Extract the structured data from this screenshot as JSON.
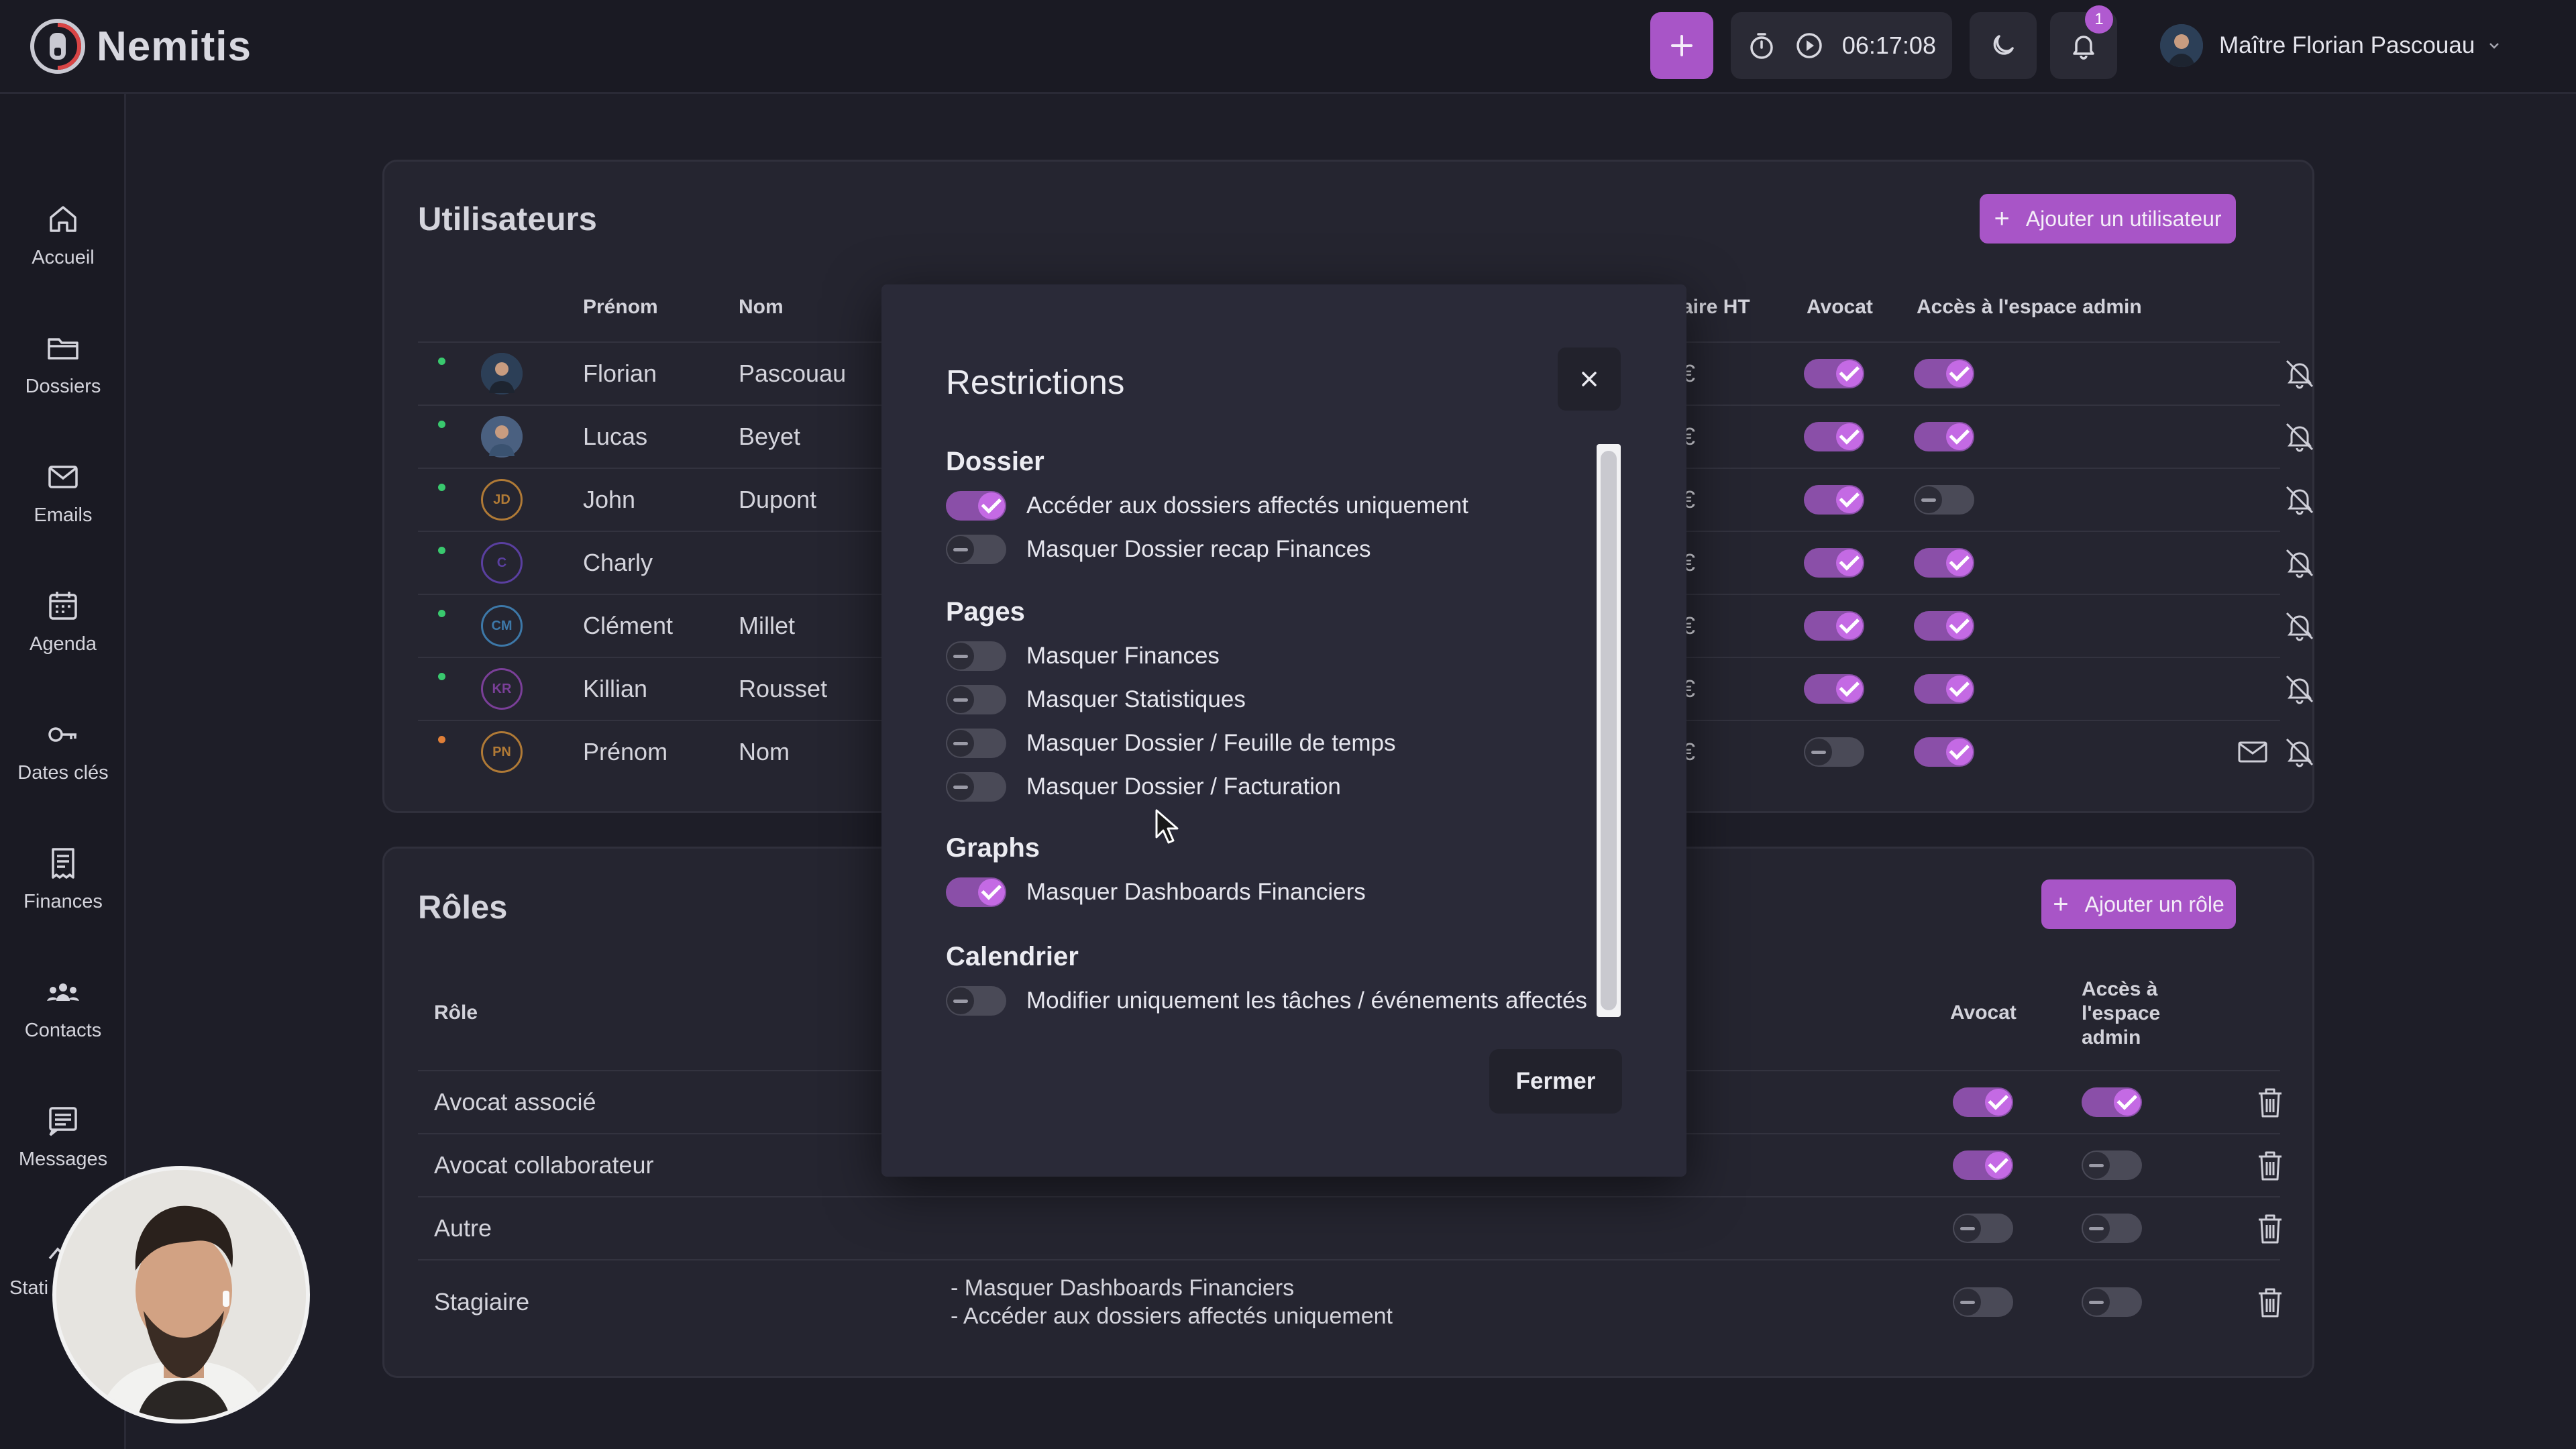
{
  "app": {
    "name": "Nemitis"
  },
  "topbar": {
    "timer": "06:17:08",
    "notifications_count": "1",
    "user_name": "Maître Florian Pascouau"
  },
  "sidebar": {
    "items": [
      {
        "label": "Accueil",
        "icon": "home-icon"
      },
      {
        "label": "Dossiers",
        "icon": "folder-icon"
      },
      {
        "label": "Emails",
        "icon": "mail-icon"
      },
      {
        "label": "Agenda",
        "icon": "calendar-icon"
      },
      {
        "label": "Dates clés",
        "icon": "key-icon"
      },
      {
        "label": "Finances",
        "icon": "receipt-icon"
      },
      {
        "label": "Contacts",
        "icon": "contacts-icon"
      },
      {
        "label": "Messages",
        "icon": "messages-icon"
      },
      {
        "label": "Stati",
        "icon": "stats-icon"
      }
    ]
  },
  "users": {
    "title": "Utilisateurs",
    "add_button": "Ajouter un utilisateur",
    "headers": {
      "firstname": "Prénom",
      "lastname": "Nom",
      "rate": "aire HT",
      "lawyer": "Avocat",
      "admin": "Accès à l'espace admin"
    },
    "rows": [
      {
        "status": "online",
        "initials": "",
        "firstname": "Florian",
        "lastname": "Pascouau",
        "rate": "€",
        "lawyer": true,
        "admin": true,
        "mail": false
      },
      {
        "status": "online",
        "initials": "",
        "firstname": "Lucas",
        "lastname": "Beyet",
        "rate": "€",
        "lawyer": true,
        "admin": true,
        "mail": false
      },
      {
        "status": "online",
        "initials": "JD",
        "firstname": "John",
        "lastname": "Dupont",
        "rate": "€",
        "lawyer": true,
        "admin": false,
        "mail": false
      },
      {
        "status": "online",
        "initials": "C",
        "firstname": "Charly",
        "lastname": "",
        "rate": "€",
        "lawyer": true,
        "admin": true,
        "mail": false
      },
      {
        "status": "online",
        "initials": "CM",
        "firstname": "Clément",
        "lastname": "Millet",
        "rate": "€",
        "lawyer": true,
        "admin": true,
        "mail": false
      },
      {
        "status": "online",
        "initials": "KR",
        "firstname": "Killian",
        "lastname": "Rousset",
        "rate": "€",
        "lawyer": true,
        "admin": true,
        "mail": false
      },
      {
        "status": "pending",
        "initials": "PN",
        "firstname": "Prénom",
        "lastname": "Nom",
        "rate": "€",
        "lawyer": false,
        "admin": true,
        "mail": true
      }
    ]
  },
  "roles": {
    "title": "Rôles",
    "add_button": "Ajouter un rôle",
    "headers": {
      "role": "Rôle",
      "lawyer": "Avocat",
      "admin_line1": "Accès à",
      "admin_line2": "l'espace",
      "admin_line3": "admin"
    },
    "rows": [
      {
        "name": "Avocat associé",
        "restrictions": [],
        "lawyer": true,
        "admin": true
      },
      {
        "name": "Avocat collaborateur",
        "restrictions": [],
        "lawyer": true,
        "admin": false
      },
      {
        "name": "Autre",
        "restrictions": [],
        "lawyer": false,
        "admin": false
      },
      {
        "name": "Stagiaire",
        "restrictions": [
          "- Masquer Dashboards Financiers",
          "- Accéder aux dossiers affectés uniquement"
        ],
        "lawyer": false,
        "admin": false
      }
    ]
  },
  "modal": {
    "title": "Restrictions",
    "close_button": "Fermer",
    "sections": [
      {
        "title": "Dossier",
        "options": [
          {
            "label": "Accéder aux dossiers affectés uniquement",
            "on": true
          },
          {
            "label": "Masquer Dossier recap Finances",
            "on": false
          }
        ]
      },
      {
        "title": "Pages",
        "options": [
          {
            "label": "Masquer Finances",
            "on": false
          },
          {
            "label": "Masquer Statistiques",
            "on": false
          },
          {
            "label": "Masquer Dossier / Feuille de temps",
            "on": false
          },
          {
            "label": "Masquer Dossier / Facturation",
            "on": false
          }
        ]
      },
      {
        "title": "Graphs",
        "options": [
          {
            "label": "Masquer Dashboards Financiers",
            "on": true
          }
        ]
      },
      {
        "title": "Calendrier",
        "options": [
          {
            "label": "Modifier uniquement les tâches / événements affectés",
            "on": false
          }
        ]
      }
    ]
  },
  "colors": {
    "accent": "#a855c7",
    "toggle_on": "#c46ae4",
    "online": "#39c96e",
    "pending": "#e07f38"
  }
}
